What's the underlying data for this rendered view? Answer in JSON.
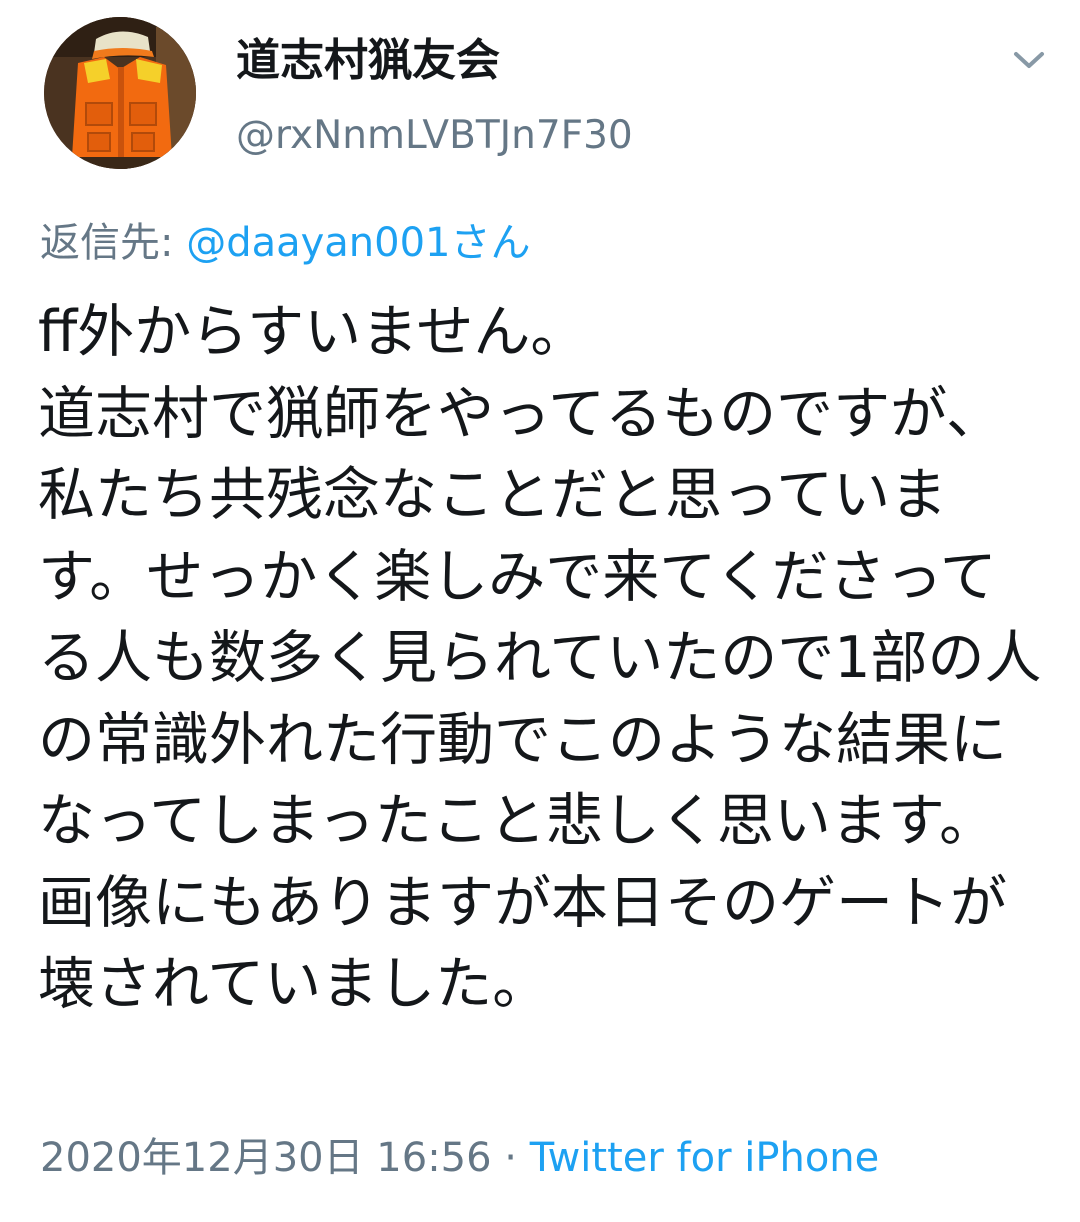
{
  "tweet": {
    "display_name": "道志村猟友会",
    "handle": "@rxNnmLVBTJn7F30",
    "reply_prefix": "返信先: ",
    "reply_mention": "@daayan001さん",
    "body": "ff外からすいません。\n道志村で猟師をやってるものですが、私たち共残念なことだと思っています。せっかく楽しみで来てくださってる人も数多く見られていたので1部の人の常識外れた行動でこのような結果になってしまったこと悲しく思います。画像にもありますが本日そのゲートが壊されていました。",
    "timestamp": "2020年12月30日 16:56",
    "separator": " · ",
    "source": "Twitter for iPhone"
  },
  "icons": {
    "menu": "chevron-down-icon",
    "avatar": "orange-hunting-vest-photo"
  },
  "colors": {
    "text": "#14171a",
    "secondary": "#657786",
    "link": "#1da1f2",
    "background": "#ffffff"
  }
}
